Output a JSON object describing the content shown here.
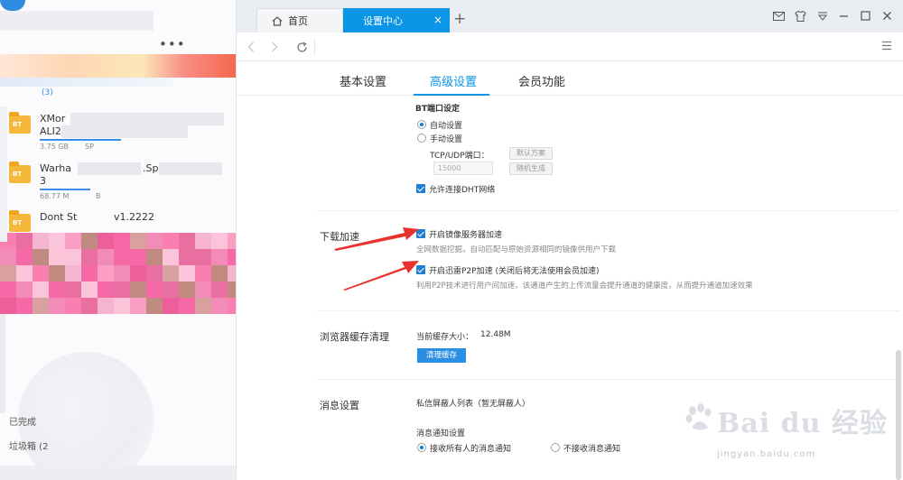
{
  "colors": {
    "accent": "#0a95e6",
    "checkbox": "#1c7fd4",
    "annotation_arrow": "#e8332d",
    "folder": "#f6b83a"
  },
  "left_panel": {
    "count_label": "(3)",
    "tasks": [
      {
        "name_line1": "XMor",
        "name_line2": "ALI2",
        "size": "3.75 GB",
        "speed": "SP",
        "type_badge": "BT"
      },
      {
        "name_line1": "Warha",
        "name_line2_suffix": ".Sp",
        "name_line2": "3",
        "size": "68.77 M",
        "speed": "B",
        "type_badge": "BT"
      },
      {
        "name_line1": "Dont St",
        "name_line1_suffix": "v1.2222",
        "size": "",
        "speed": "",
        "type_badge": "BT"
      }
    ],
    "footer": {
      "completed": "已完成",
      "trash": "垃圾箱 (2"
    }
  },
  "tabs": {
    "home_label": "首页",
    "active_label": "设置中心",
    "close_glyph": "×",
    "add_glyph": "+"
  },
  "window_icons": [
    "mail-icon",
    "shirt-icon",
    "dropdown-icon",
    "minimize-icon",
    "maximize-icon",
    "close-icon"
  ],
  "settings": {
    "subtabs": [
      "基本设置",
      "高级设置",
      "会员功能"
    ],
    "active_subtab": "高级设置",
    "bt_port": {
      "title": "BT端口设定",
      "auto_label": "自动设置",
      "manual_label": "手动设置",
      "mode": "auto",
      "tcp_udp_label": "TCP/UDP端口：",
      "port_value": "15000",
      "default_btn": "默认方案",
      "random_btn": "随机生成",
      "dht_label": "允许连接DHT网络",
      "dht_checked": true
    },
    "download_accel": {
      "section": "下载加速",
      "mirror_label": "开启镜像服务器加速",
      "mirror_checked": true,
      "mirror_desc": "全网数据挖掘，自动匹配与原始资源相同的镜像供用户下载",
      "p2p_label": "开启迅雷P2P加速 (关闭后将无法使用会员加速)",
      "p2p_checked": true,
      "p2p_desc": "利用P2P技术进行用户间加速，该通道产生的上传流量会提升通道的健康度，从而提升通道加速效果"
    },
    "browser_cache": {
      "section": "浏览器缓存清理",
      "size_label": "当前缓存大小：",
      "size_value": "12.48M",
      "clear_btn": "清理缓存"
    },
    "messages": {
      "section": "消息设置",
      "blocked_label": "私信屏蔽人列表（暂无屏蔽人）",
      "notify_title": "消息通知设置",
      "accept_all": "接收所有人的消息通知",
      "reject": "不接收消息通知",
      "mode": "accept_all"
    }
  },
  "watermark": {
    "main": "Bai du 经验",
    "sub": "jingyan.baidu.com"
  }
}
